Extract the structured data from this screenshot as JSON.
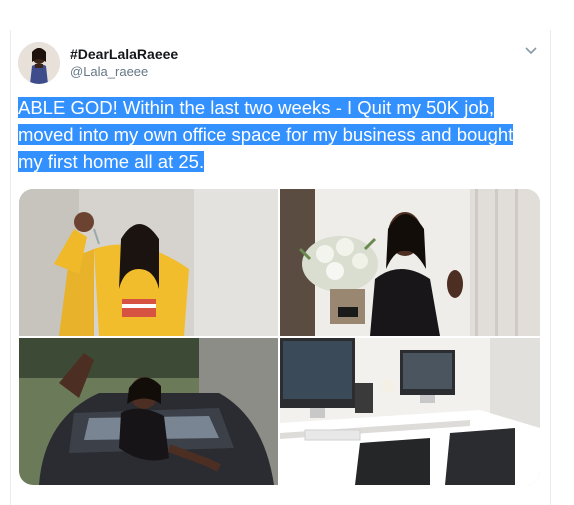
{
  "tweet": {
    "display_name": "#DearLalaRaeee",
    "handle": "@Lala_raeee",
    "text": "ABLE GOD! Within the last two weeks - I Quit my 50K job, moved into my own office space for my business and bought my first home all at 25."
  },
  "icons": {
    "menu": "chevron-down-icon"
  },
  "colors": {
    "selection": "#3390ff",
    "handle": "#657786",
    "border": "#e6ecf0"
  }
}
